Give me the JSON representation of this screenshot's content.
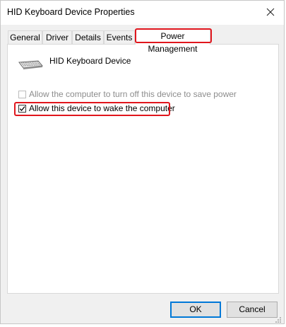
{
  "window": {
    "title": "HID Keyboard Device Properties",
    "close_icon": "close-icon"
  },
  "tabs": [
    {
      "label": "General",
      "active": false
    },
    {
      "label": "Driver",
      "active": false
    },
    {
      "label": "Details",
      "active": false
    },
    {
      "label": "Events",
      "active": false
    },
    {
      "label": "Power Management",
      "active": true
    }
  ],
  "device": {
    "name": "HID Keyboard Device",
    "icon": "keyboard-icon"
  },
  "options": [
    {
      "label": "Allow the computer to turn off this device to save power",
      "checked": false,
      "enabled": false
    },
    {
      "label": "Allow this device to wake the computer",
      "checked": true,
      "enabled": true
    }
  ],
  "buttons": {
    "ok_label": "OK",
    "cancel_label": "Cancel"
  },
  "colors": {
    "highlight": "#e0161d",
    "default_button_border": "#0078d7"
  }
}
